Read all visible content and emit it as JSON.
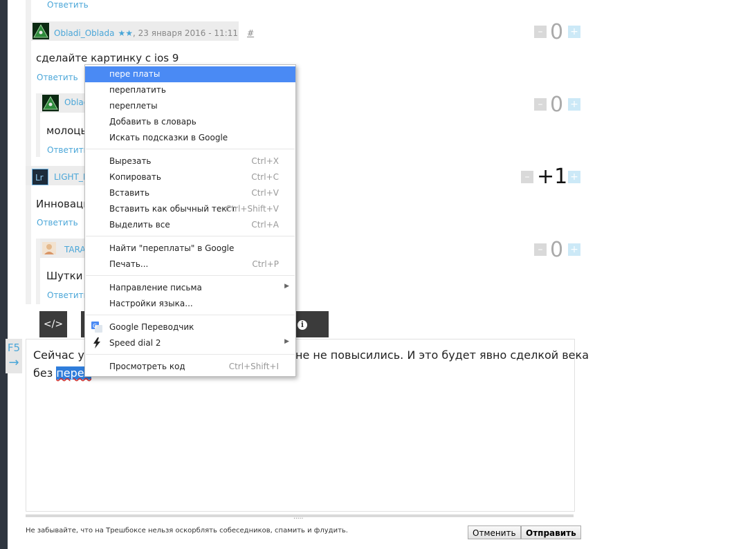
{
  "thread": {
    "top_reply": "Ответить",
    "comments": [
      {
        "author": "Obladi_Oblada",
        "stars": "★★",
        "date": ", 23 января 2016 - 11:11",
        "hash": "#",
        "text": "сделайте картинку с ios 9",
        "reply": "Ответить",
        "score": "0"
      },
      {
        "author": "Oblad",
        "text": "молоцы",
        "reply": "Ответить",
        "score": "0"
      },
      {
        "author": "LIGHT_E",
        "text": "Инноваци",
        "reply": "Ответить",
        "score": "+1"
      },
      {
        "author": "TARA",
        "text": "Шутки з",
        "reply": "Ответить",
        "score": "0"
      }
    ],
    "vote_minus": "–",
    "vote_plus": "+"
  },
  "toolbar": {
    "code_label": "</>",
    "info_label": "i"
  },
  "side_tab": {
    "label": "F5",
    "arrow": "→"
  },
  "editor": {
    "line1_start": "Сейчас уж",
    "line1_end": "не не повысились. И это будет явно сделкой века",
    "line2_start": "без ",
    "misspelled": "переп"
  },
  "context_menu": {
    "suggestions": [
      "пере платы",
      "переплатить",
      "переплеты"
    ],
    "add_to_dictionary": "Добавить в словарь",
    "search_hints": "Искать подсказки в Google",
    "cut": {
      "label": "Вырезать",
      "shortcut": "Ctrl+X"
    },
    "copy": {
      "label": "Копировать",
      "shortcut": "Ctrl+C"
    },
    "paste": {
      "label": "Вставить",
      "shortcut": "Ctrl+V"
    },
    "paste_plain": {
      "label": "Вставить как обычный текст",
      "shortcut": "Ctrl+Shift+V"
    },
    "select_all": {
      "label": "Выделить все",
      "shortcut": "Ctrl+A"
    },
    "search_google": {
      "label": "Найти \"переплаты\" в Google"
    },
    "print": {
      "label": "Печать...",
      "shortcut": "Ctrl+P"
    },
    "writing_direction": {
      "label": "Направление письма"
    },
    "language_settings": {
      "label": "Настройки языка..."
    },
    "translator": {
      "label": "Google Переводчик"
    },
    "speed_dial": {
      "label": "Speed dial 2"
    },
    "inspect": {
      "label": "Просмотреть код",
      "shortcut": "Ctrl+Shift+I"
    }
  },
  "footer": {
    "notice": "Не забывайте, что на Трешбоксе нельзя оскорблять собеседников, спамить и флудить.",
    "cancel_label": "Отменить",
    "submit_label": "Отправить",
    "resize_handle": "....."
  },
  "colors": {
    "accent": "#4aa6d8",
    "menu_highlight": "#4a8af4",
    "toolbar": "#3b3b3b"
  }
}
